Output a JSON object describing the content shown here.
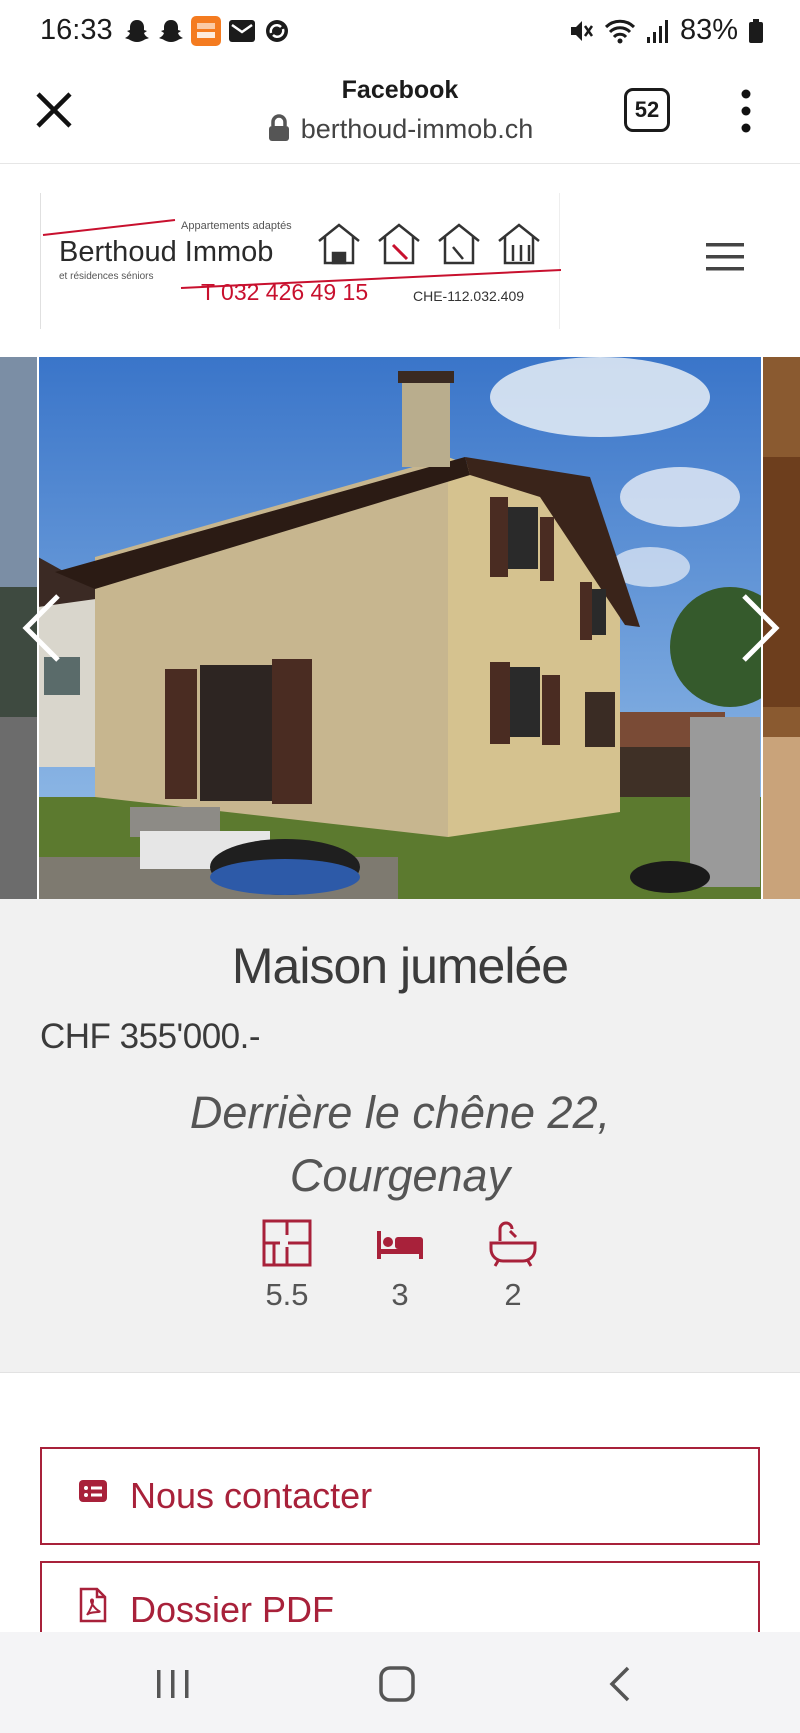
{
  "status": {
    "time": "16:33",
    "battery": "83%",
    "notification_icons": [
      "snapchat-icon",
      "snapchat-icon",
      "temu-icon",
      "mail-icon",
      "sync-icon"
    ],
    "system_icons": [
      "mute-icon",
      "wifi-icon",
      "signal-icon",
      "battery-icon"
    ]
  },
  "browser": {
    "title": "Facebook",
    "url": "berthoud-immob.ch",
    "tab_count": "52"
  },
  "logo": {
    "tagline": "Appartements adaptés",
    "name": "Berthoud Immob",
    "subtitle": "et résidences séniors",
    "phone": "T 032 426 49 15",
    "uid": "CHE-112.032.409"
  },
  "property": {
    "title": "Maison jumelée",
    "price": "CHF 355'000.-",
    "address_line1": "Derrière le chêne 22,",
    "address_line2": "Courgenay",
    "rooms": "5.5",
    "bedrooms": "3",
    "bathrooms": "2"
  },
  "actions": {
    "contact_label": "Nous contacter",
    "pdf_label": "Dossier PDF"
  },
  "colors": {
    "brand_red": "#a8213a",
    "logo_red": "#c8102e"
  }
}
